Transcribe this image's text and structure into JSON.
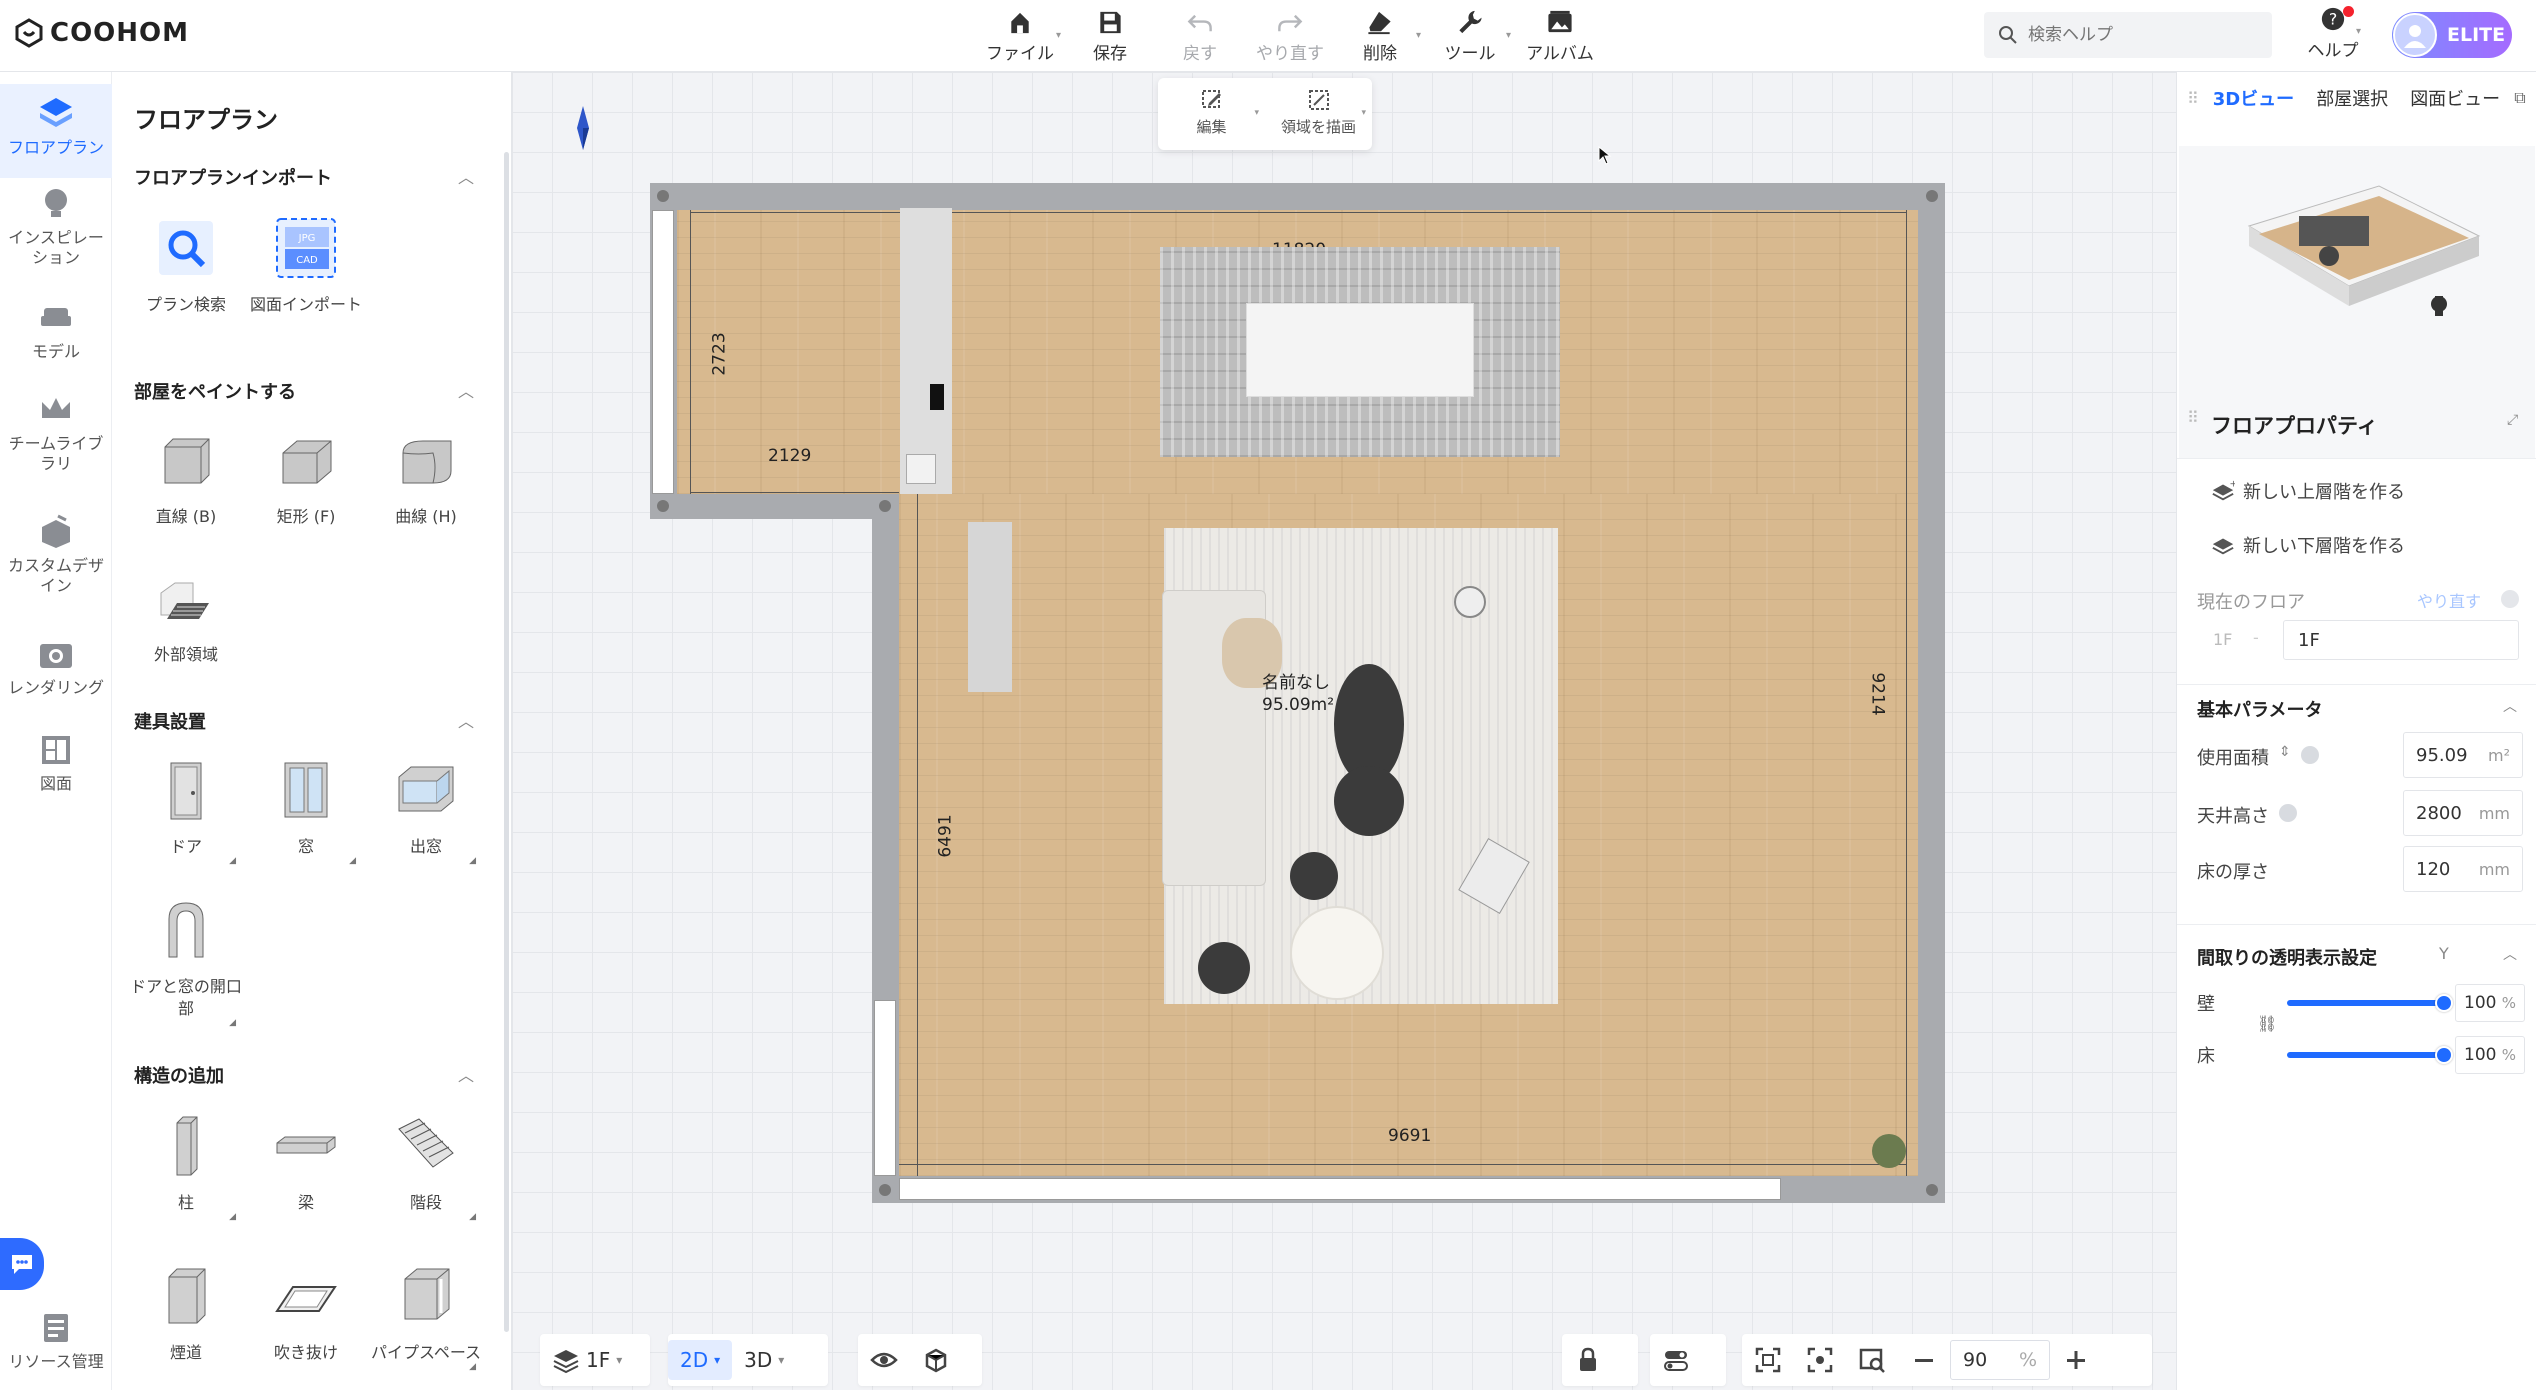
{
  "app": {
    "logo_text": "COOHOM"
  },
  "top_tools": [
    {
      "label": "ファイル",
      "icon": "home-file-icon",
      "caret": true,
      "disabled": false
    },
    {
      "label": "保存",
      "icon": "save-icon",
      "caret": false,
      "disabled": false
    },
    {
      "label": "戻す",
      "icon": "undo-icon",
      "caret": false,
      "disabled": true
    },
    {
      "label": "やり直す",
      "icon": "redo-icon",
      "caret": false,
      "disabled": true
    },
    {
      "label": "削除",
      "icon": "eraser-icon",
      "caret": true,
      "disabled": false
    },
    {
      "label": "ツール",
      "icon": "wrench-icon",
      "caret": true,
      "disabled": false
    },
    {
      "label": "アルバム",
      "icon": "album-icon",
      "caret": false,
      "disabled": false
    }
  ],
  "search": {
    "placeholder": "検索ヘルプ"
  },
  "help": {
    "label": "ヘルプ"
  },
  "user": {
    "badge": "ELITE"
  },
  "left_nav": [
    {
      "label": "フロアプラン",
      "icon": "floorplan-icon",
      "active": true
    },
    {
      "label": "インスピレーション",
      "icon": "lightbulb-icon",
      "active": false
    },
    {
      "label": "モデル",
      "icon": "sofa-icon",
      "active": false
    },
    {
      "label": "チームライブラリ",
      "icon": "crown-icon",
      "active": false
    },
    {
      "label": "カスタムデザイン",
      "icon": "custom-design-icon",
      "active": false
    },
    {
      "label": "レンダリング",
      "icon": "camera-icon",
      "active": false
    },
    {
      "label": "図面",
      "icon": "drawing-icon",
      "active": false
    },
    {
      "label": "リソース管理",
      "icon": "resource-icon",
      "active": false
    }
  ],
  "library": {
    "title": "フロアプラン",
    "sections": [
      {
        "title": "フロアプランインポート",
        "items": [
          "プラン検索",
          "図面インポート"
        ]
      },
      {
        "title": "部屋をペイントする",
        "items": [
          "直線 (B)",
          "矩形 (F)",
          "曲線 (H)",
          "外部領域"
        ]
      },
      {
        "title": "建具設置",
        "items": [
          "ドア",
          "窓",
          "出窓",
          "ドアと窓の開口部"
        ]
      },
      {
        "title": "構造の追加",
        "items": [
          "柱",
          "梁",
          "階段",
          "煙道",
          "吹き抜け",
          "パイプスペース"
        ]
      }
    ]
  },
  "canvas": {
    "float_toolbar": [
      {
        "label": "編集"
      },
      {
        "label": "領域を描画"
      }
    ],
    "dimensions": {
      "top": "11820",
      "left_upper": "2723",
      "left_inner": "2129",
      "left_lower": "6491",
      "right": "9214",
      "bottom": "9691"
    },
    "room": {
      "name": "名前なし",
      "area": "95.09m²"
    }
  },
  "bottom_bar": {
    "floor": "1F",
    "view_2d": "2D",
    "view_3d": "3D",
    "zoom_value": "90",
    "zoom_unit": "%"
  },
  "right_panel": {
    "tabs": [
      "3Dビュー",
      "部屋選択",
      "図面ビュー"
    ],
    "property_title": "フロアプロパティ",
    "actions": [
      "新しい上層階を作る",
      "新しい下層階を作る"
    ],
    "current_floor": {
      "label": "現在のフロア",
      "redo": "やり直す",
      "floor_code": "1F",
      "floor_value": "1F"
    },
    "basic_params": {
      "title": "基本パラメータ",
      "rows": [
        {
          "label": "使用面積",
          "value": "95.09",
          "unit": "m²"
        },
        {
          "label": "天井高さ",
          "value": "2800",
          "unit": "mm"
        },
        {
          "label": "床の厚さ",
          "value": "120",
          "unit": "mm"
        }
      ]
    },
    "transparency": {
      "title": "間取りの透明表示設定",
      "hotkey": "Y",
      "rows": [
        {
          "label": "壁",
          "value": "100",
          "unit": "%"
        },
        {
          "label": "床",
          "value": "100",
          "unit": "%"
        }
      ]
    }
  },
  "colors": {
    "accent": "#1f6bff",
    "wall": "#a9abaf",
    "wood": "#d8b98f"
  }
}
